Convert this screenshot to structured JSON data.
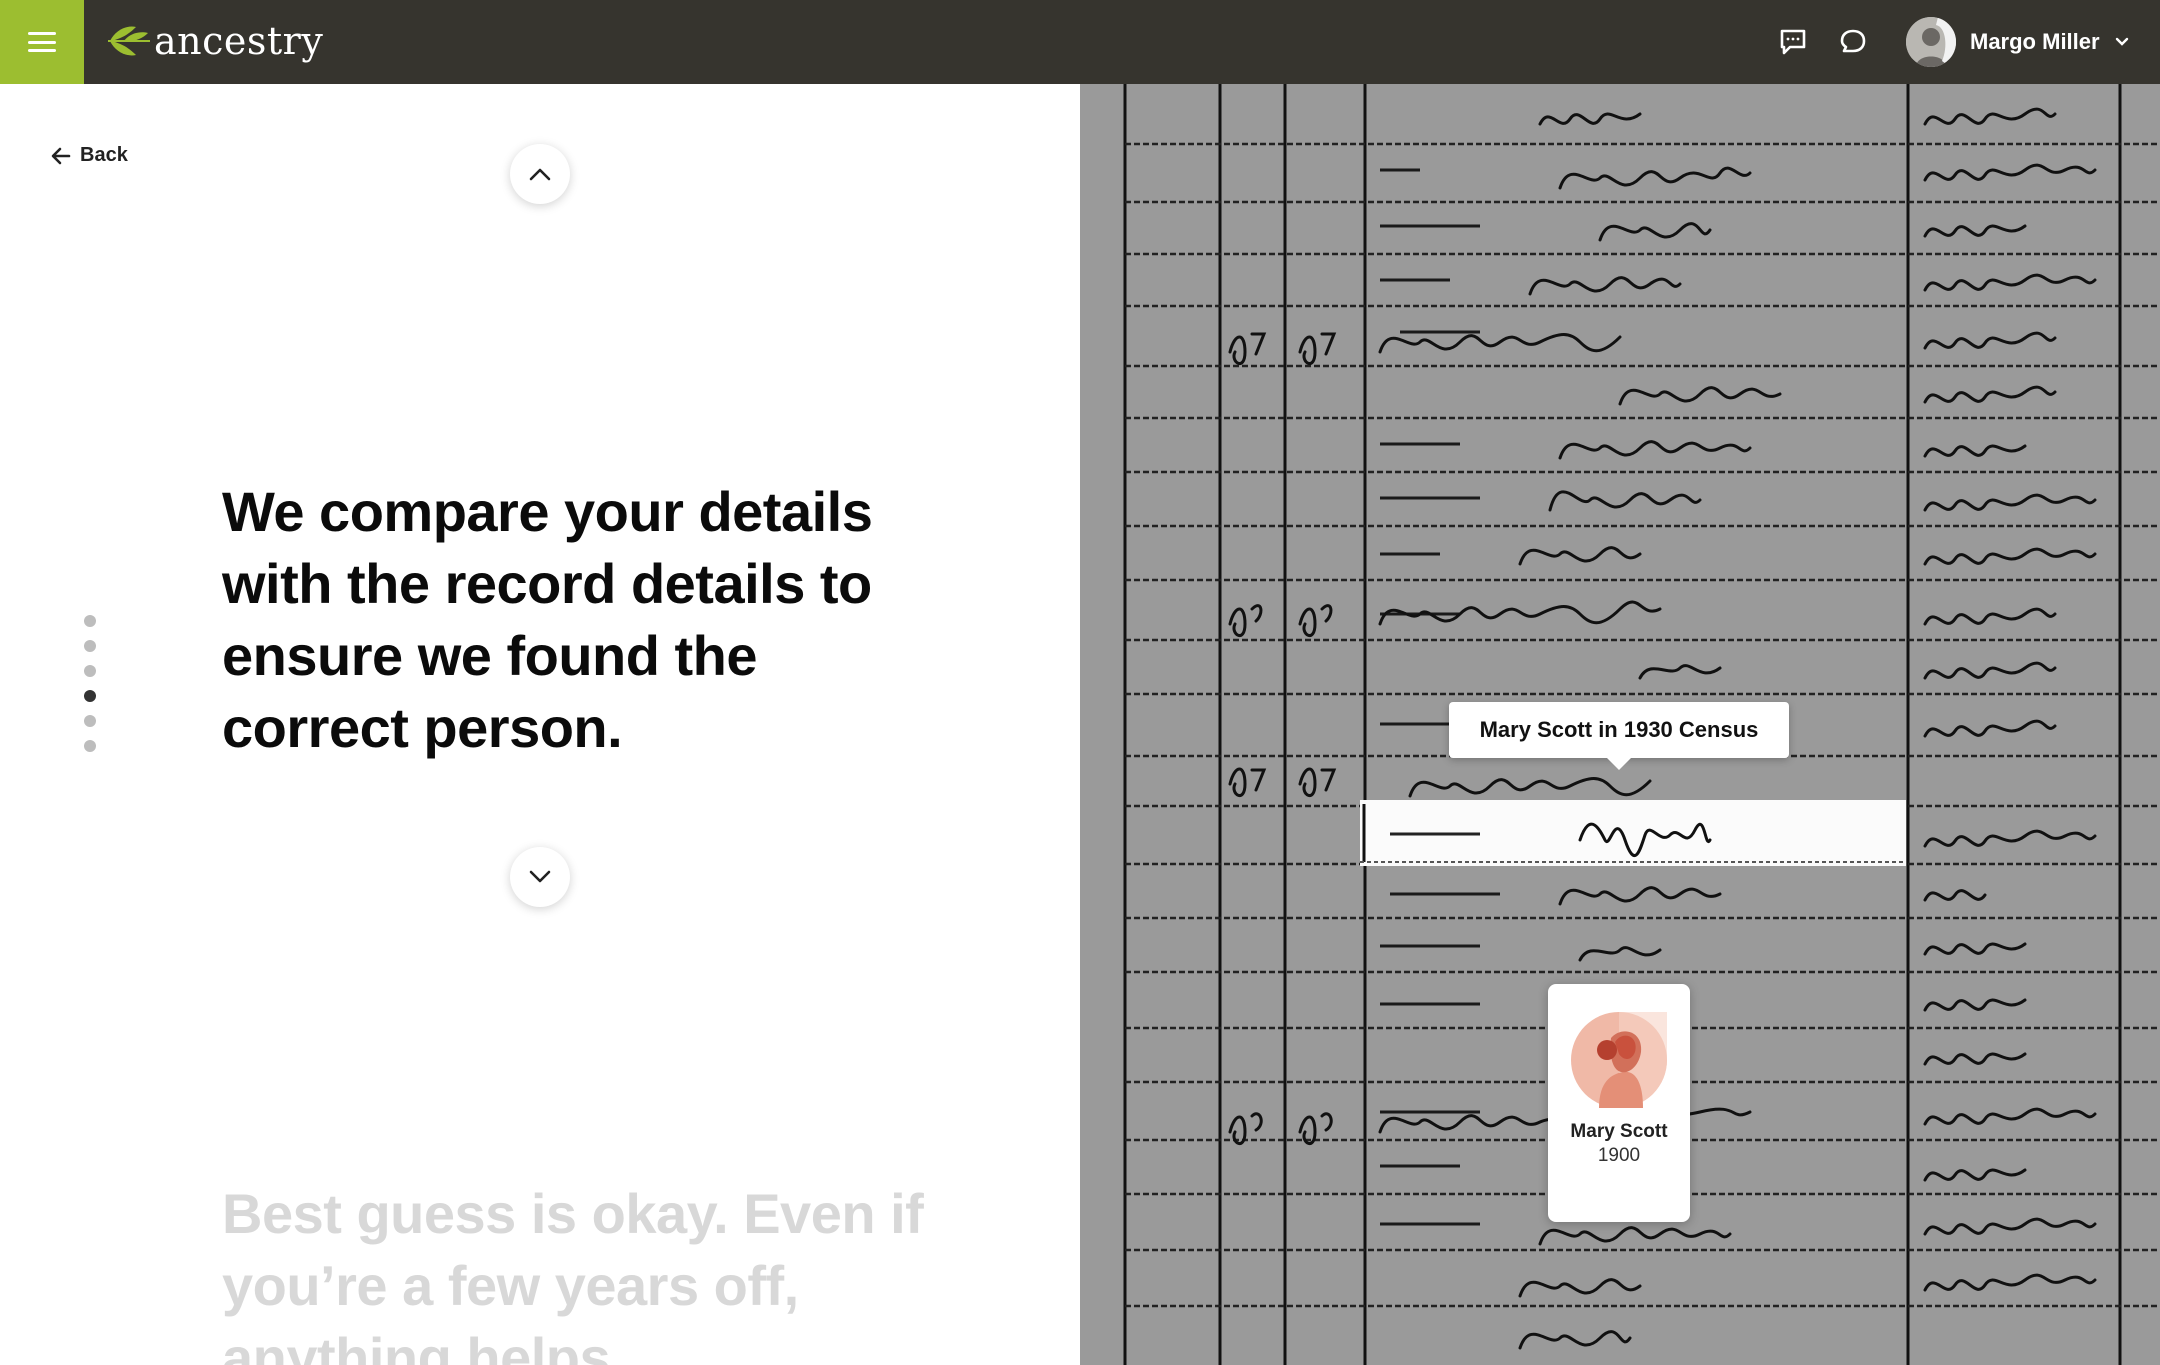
{
  "header": {
    "logo_text": "ancestry",
    "menu_icon": "hamburger-menu-icon",
    "messages_icon": "message-icon",
    "chat_icon": "chat-bubble-icon",
    "user_name": "Margo Miller",
    "brand_green": "#9cbe30",
    "header_bg": "#36342e"
  },
  "left": {
    "back_label": "Back",
    "headline": "We compare your details with the record details to ensure we found the correct person.",
    "next_text": "Best guess is okay. Even if you’re a few years off, anything helps.",
    "progress": {
      "total_steps": 6,
      "current_step": 4
    }
  },
  "record": {
    "tooltip": "Mary Scott in 1930 Census",
    "card_name": "Mary Scott",
    "card_year": "1900"
  }
}
